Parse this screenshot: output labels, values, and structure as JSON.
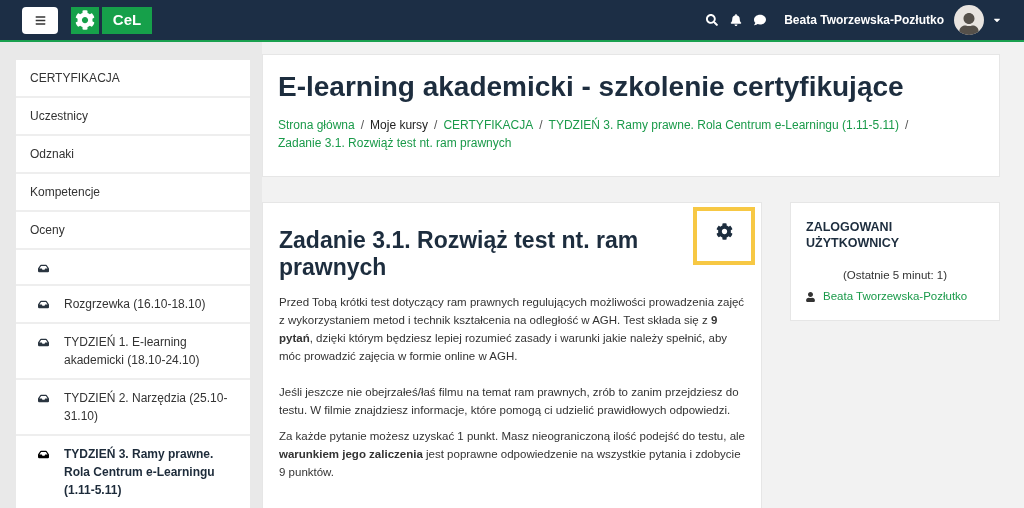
{
  "navbar": {
    "brand": "CeL",
    "user_name": "Beata Tworzewska-Pozłutko"
  },
  "sidebar": {
    "items": [
      {
        "kind": "link",
        "label": "CERTYFIKACJA",
        "selected": false
      },
      {
        "kind": "link",
        "label": "Uczestnicy",
        "selected": false
      },
      {
        "kind": "link",
        "label": "Odznaki",
        "selected": false
      },
      {
        "kind": "link",
        "label": "Kompetencje",
        "selected": false
      },
      {
        "kind": "link",
        "label": "Oceny",
        "selected": false
      },
      {
        "kind": "section",
        "selected": false
      },
      {
        "kind": "section",
        "label": "Rozgrzewka (16.10-18.10)",
        "selected": false
      },
      {
        "kind": "section",
        "label": "TYDZIEŃ 1. E-learning akademicki (18.10-24.10)",
        "selected": false
      },
      {
        "kind": "section",
        "label": "TYDZIEŃ 2. Narzędzia (25.10-31.10)",
        "selected": false
      },
      {
        "kind": "section",
        "label": "TYDZIEŃ 3. Ramy prawne. Rola Centrum e-Learningu (1.11-5.11)",
        "selected": true
      }
    ]
  },
  "header": {
    "title": "E-learning akademicki - szkolenie certyfikujące",
    "breadcrumb": [
      {
        "label": "Strona główna",
        "link": true
      },
      {
        "separator": "/",
        "label": "Moje kursy",
        "link": false
      },
      {
        "separator": "/",
        "label": "CERTYFIKACJA",
        "link": true
      },
      {
        "separator": "/",
        "label": "TYDZIEŃ 3. Ramy prawne. Rola Centrum e-Learningu (1.11-5.11)",
        "link": true
      },
      {
        "separator": "/",
        "label": "Zadanie 3.1. Rozwiąż test nt. ram prawnych",
        "link": true
      }
    ]
  },
  "activity": {
    "title": "Zadanie 3.1. Rozwiąż test nt. ram prawnych",
    "settings_highlighted": true,
    "paragraphs": [
      "Przed Tobą krótki test dotyczący ram prawnych regulujących możliwości prowadzenia zajęć z wykorzystaniem metod i technik kształcenia na odległość w AGH. Test składa się z **9 pytań**, dzięki którym będziesz lepiej rozumieć zasady i warunki jakie należy spełnić, aby móc prowadzić zajęcia w formie online w AGH.",
      "Jeśli jeszcze nie obejrzałeś/łaś filmu na temat ram prawnych, zrób to zanim przejdziesz do testu. W filmie  znajdziesz informacje, które pomogą ci udzielić prawidłowych odpowiedzi.",
      "Za każde pytanie możesz uzyskać 1 punkt. Masz nieograniczoną ilość podejść do testu, ale **warunkiem jego zaliczenia** jest poprawne odpowiedzenie na wszystkie pytania i zdobycie 9 punktów."
    ]
  },
  "online_users": {
    "title": "ZALOGOWANI UŻYTKOWNICY",
    "summary": "(Ostatnie 5 minut: 1)",
    "users": [
      "Beata Tworzewska-Pozłutko"
    ]
  }
}
